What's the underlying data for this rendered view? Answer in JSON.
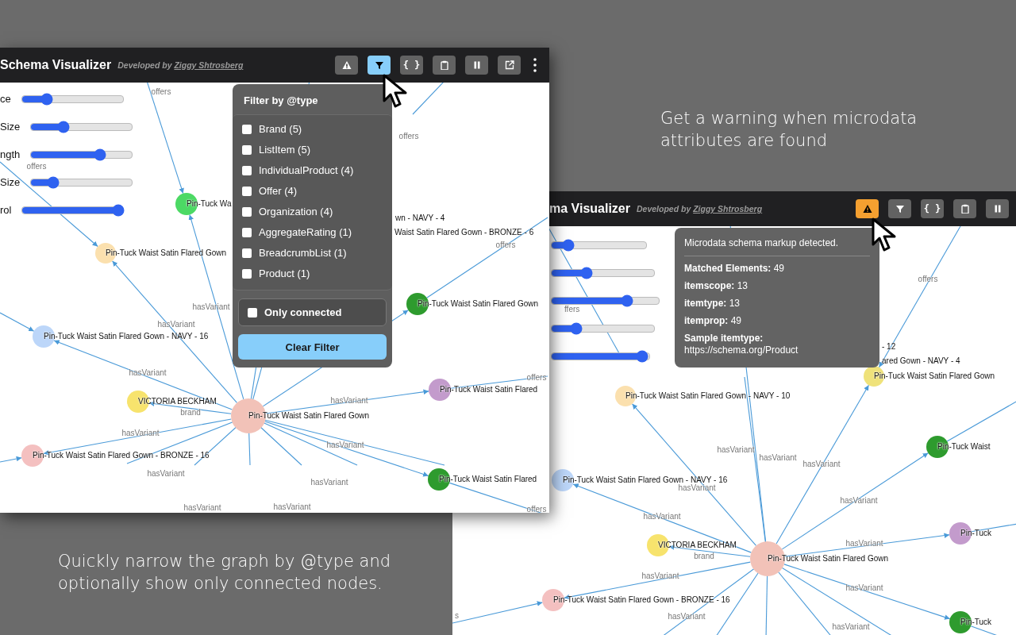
{
  "captions": [
    {
      "kind": "top",
      "text": "Get a warning when microdata attributes are found"
    },
    {
      "kind": "bottom",
      "text": "Quickly narrow the graph by @type and optionally show only connected nodes."
    }
  ],
  "windows": [
    {
      "title": "Schema Visualizer",
      "credit": "Developed by",
      "credit_link": "Ziggy Shtrosberg",
      "toolbar": [
        {
          "kind": "warning",
          "selected": false
        },
        {
          "kind": "filter",
          "selected": true
        },
        {
          "kind": "json",
          "label": "{ }",
          "selected": false
        },
        {
          "kind": "clipboard",
          "selected": false
        },
        {
          "kind": "pause",
          "selected": false
        },
        {
          "kind": "external",
          "selected": false
        },
        {
          "kind": "more",
          "selected": false
        }
      ],
      "sliders": [
        {
          "label": "ce",
          "level": 0.25
        },
        {
          "label": "Size",
          "level": 0.32
        },
        {
          "label": "ngth",
          "level": 0.68
        },
        {
          "label": "Size",
          "level": 0.22
        },
        {
          "label": "rol",
          "level": 0.95
        }
      ],
      "graph": {
        "nodes": [
          {
            "label": "Pin-Tuck Wa",
            "color": "#4cd964"
          },
          {
            "label": "Pin-Tuck Waist Satin Flared Gown",
            "color": "#fbe0ae"
          },
          {
            "label": "Pin-Tuck Waist Satin Flared Gown",
            "color": "#2e9b2e"
          },
          {
            "label": "Pin-Tuck Waist Satin Flared Gown - NAVY - 16",
            "color": "#bcd6f9"
          },
          {
            "label": "VICTORIA BECKHAM",
            "color": "#f7e36d"
          },
          {
            "label": "Pin-Tuck Waist Satin Flared Gown",
            "color": "#f2c2b8"
          },
          {
            "label": "Pin-Tuck Waist Satin Flared",
            "color": "#c39bcc"
          },
          {
            "label": "Pin-Tuck Waist Satin Flared Gown - BRONZE - 16",
            "color": "#f4c0c0"
          },
          {
            "label": "Pin-Tuck Waist Satin Flared",
            "color": "#2e9b2e"
          }
        ],
        "partial_labels": [
          "wn - NAVY - 4",
          "Waist Satin Flared Gown - BRONZE - 6"
        ],
        "edge_labels": [
          "offers",
          "offers",
          "offers",
          "offers",
          "offers",
          "offers",
          "hasVariant",
          "hasVariant",
          "hasVariant",
          "hasVariant",
          "hasVariant",
          "hasVariant",
          "hasVariant",
          "hasVariant",
          "hasVariant",
          "hasVariant",
          "brand"
        ]
      },
      "filter_panel": {
        "title": "Filter by @type",
        "types": [
          {
            "label": "Brand (5)",
            "checked": false
          },
          {
            "label": "ListItem (5)",
            "checked": false
          },
          {
            "label": "IndividualProduct (4)",
            "checked": false
          },
          {
            "label": "Offer (4)",
            "checked": false
          },
          {
            "label": "Organization (4)",
            "checked": false
          },
          {
            "label": "AggregateRating (1)",
            "checked": false
          },
          {
            "label": "BreadcrumbList (1)",
            "checked": false
          },
          {
            "label": "Product (1)",
            "checked": false
          }
        ],
        "only_connected": {
          "label": "Only connected",
          "checked": false
        },
        "clear_button": "Clear Filter"
      }
    },
    {
      "title": "ma Visualizer",
      "credit": "Developed by",
      "credit_link": "Ziggy Shtrosberg",
      "toolbar": [
        {
          "kind": "warning",
          "selected": true
        },
        {
          "kind": "filter",
          "selected": false
        },
        {
          "kind": "json",
          "label": "{ }",
          "selected": false
        },
        {
          "kind": "clipboard",
          "selected": false
        },
        {
          "kind": "pause",
          "selected": false
        }
      ],
      "sliders": [
        {
          "level": 0.18
        },
        {
          "level": 0.34
        },
        {
          "level": 0.7
        },
        {
          "level": 0.24
        },
        {
          "level": 0.93
        }
      ],
      "graph": {
        "nodes": [
          {
            "label": "Pin-Tuck Waist Satin Flared Gown",
            "color": "#efe27a"
          },
          {
            "label": "Pin-Tuck Waist Satin Flared Gown - NAVY - 10",
            "color": "#fbe0ae"
          },
          {
            "label": "Pin-Tuck Waist",
            "color": "#2e9b2e"
          },
          {
            "label": "Pin-Tuck Waist Satin Flared Gown - NAVY - 16",
            "color": "#bcd6f9"
          },
          {
            "label": "Pin-Tuck",
            "color": "#c39bcc"
          },
          {
            "label": "VICTORIA BECKHAM",
            "color": "#f7e36d"
          },
          {
            "label": "Pin-Tuck Waist Satin Flared Gown",
            "color": "#f2c2b8"
          },
          {
            "label": "Pin-Tuck Waist Satin Flared Gown - BRONZE - 16",
            "color": "#f4c0c0"
          },
          {
            "label": "Pin-Tuck",
            "color": "#2e9b2e"
          }
        ],
        "partial_labels": [
          "- 12",
          "ared Gown - NAVY - 4"
        ],
        "edge_labels": [
          "offers",
          "ffers",
          "s",
          "hasVariant",
          "hasVariant",
          "hasVariant",
          "hasVariant",
          "hasVariant",
          "hasVariant",
          "hasVariant",
          "hasVariant",
          "hasVariant",
          "hasVariant",
          "hasVariant",
          "brand"
        ]
      },
      "info_panel": {
        "message": "Microdata schema markup detected.",
        "stats": [
          "**Matched Elements:** 49",
          "**itemscope:** 13",
          "**itemtype:** 13",
          "**itemprop:** 49"
        ],
        "sample_label": "Sample itemtype:",
        "sample_value": "https://schema.org/Product"
      }
    }
  ]
}
